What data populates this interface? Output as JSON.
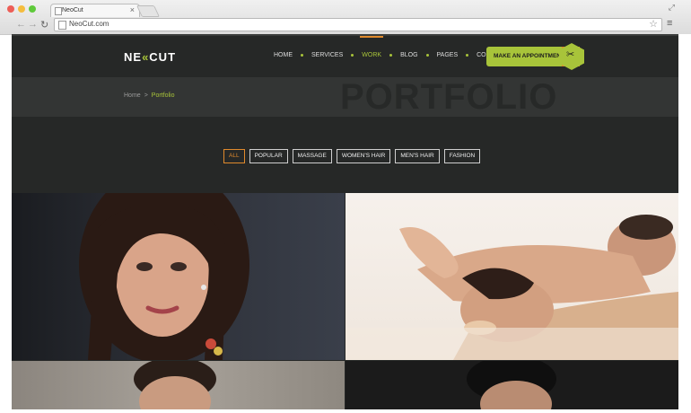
{
  "browser": {
    "tab_title": "NeoCut",
    "url": "NeoCut.com",
    "colors": {
      "close": "#ed5e57",
      "minimize": "#f5bd3e",
      "maximize": "#5fca3b"
    }
  },
  "site": {
    "logo": {
      "part1": "NE",
      "accent": "«",
      "part2": "CUT"
    },
    "nav": [
      "HOME",
      "SERVICES",
      "WORK",
      "BLOG",
      "PAGES",
      "CONTACT"
    ],
    "active_nav": "WORK",
    "cta_label": "MAKE AN APPOINTMENT",
    "breadcrumb": {
      "home": "Home",
      "separator": ">",
      "current": "Portfolio"
    },
    "page_title": "PORTFOLIO",
    "filters": [
      "ALL",
      "POPULAR",
      "MASSAGE",
      "WOMEN'S HAIR",
      "MEN'S HAIR",
      "FASHION"
    ],
    "active_filter": "ALL",
    "accent_color": "#a8c43a",
    "orange_color": "#e08a2c",
    "icons": [
      "scissors-icon",
      "star-icon",
      "menu-icon",
      "back-icon",
      "forward-icon",
      "reload-icon"
    ]
  }
}
